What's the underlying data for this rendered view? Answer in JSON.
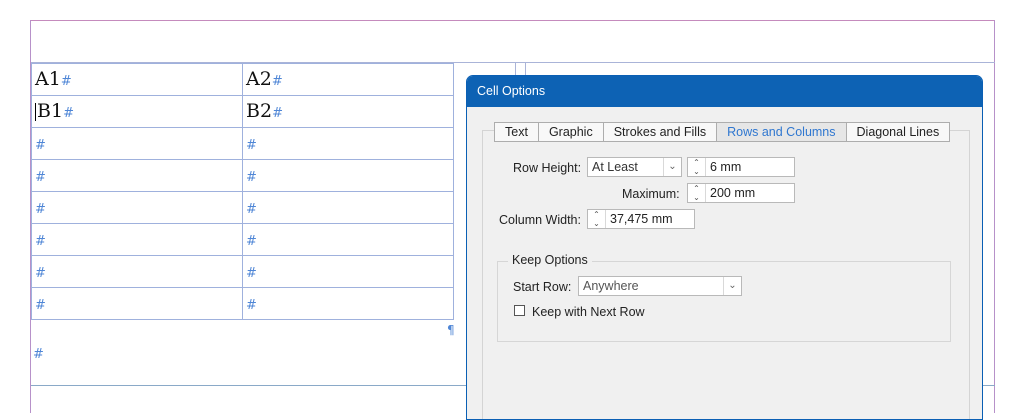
{
  "document": {
    "table": {
      "rows": [
        [
          "A1",
          "A2"
        ],
        [
          "B1",
          "B2"
        ],
        [
          "",
          ""
        ],
        [
          "",
          ""
        ],
        [
          "",
          ""
        ],
        [
          "",
          ""
        ],
        [
          "",
          ""
        ],
        [
          "",
          ""
        ]
      ],
      "end_of_cell_marker": "#",
      "end_of_story_marker": "¶"
    }
  },
  "dialog": {
    "title": "Cell Options",
    "tabs": [
      {
        "label": "Text",
        "active": false
      },
      {
        "label": "Graphic",
        "active": false
      },
      {
        "label": "Strokes and Fills",
        "active": false
      },
      {
        "label": "Rows and Columns",
        "active": true
      },
      {
        "label": "Diagonal Lines",
        "active": false
      }
    ],
    "row_height": {
      "label": "Row Height:",
      "mode": "At Least",
      "value": "6 mm"
    },
    "maximum": {
      "label": "Maximum:",
      "value": "200 mm"
    },
    "column_width": {
      "label": "Column Width:",
      "value": "37,475 mm"
    },
    "keep_options": {
      "title": "Keep Options",
      "start_row_label": "Start Row:",
      "start_row_value": "Anywhere",
      "keep_with_next_label": "Keep with Next Row",
      "keep_with_next_checked": false
    }
  },
  "colors": {
    "accent": "#0d62b4",
    "active_tab_text": "#2f77d0",
    "marker": "#4f86d6"
  }
}
